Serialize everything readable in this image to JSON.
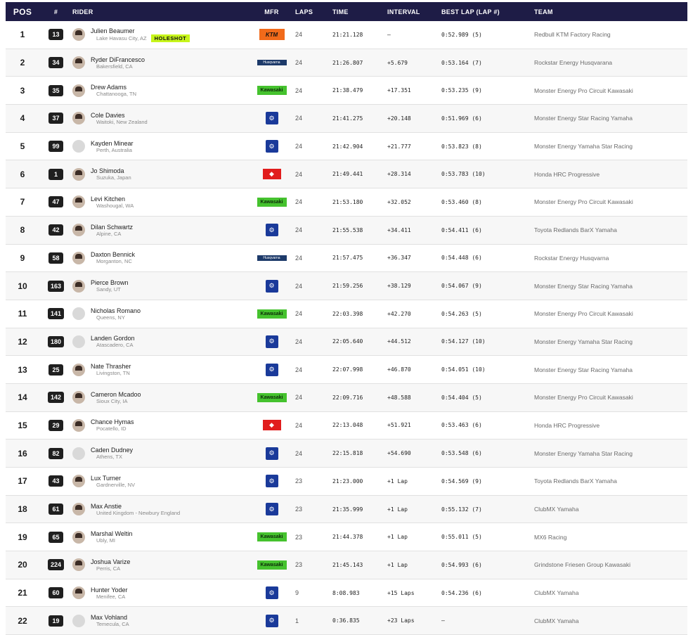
{
  "headers": {
    "pos": "POS",
    "num": "#",
    "rider": "RIDER",
    "mfr": "MFR",
    "laps": "LAPS",
    "time": "TIME",
    "interval": "INTERVAL",
    "best_lap": "BEST LAP (LAP #)",
    "team": "TEAM"
  },
  "holeshot_label": "HOLESHOT",
  "manufacturer_logos": {
    "ktm": "KTM",
    "husqvarna": "Husqvarna",
    "kawasaki": "Kawasaki",
    "yamaha": "⚙",
    "honda": "◆"
  },
  "rows": [
    {
      "pos": "1",
      "num": "13",
      "name": "Julien Beaumer",
      "loc": "Lake Havasu City, AZ",
      "holeshot": true,
      "mfr": "ktm",
      "laps": "24",
      "time": "21:21.128",
      "interval": "–",
      "best": "0:52.989 (5)",
      "team": "Redbull KTM Factory Racing",
      "photo": true
    },
    {
      "pos": "2",
      "num": "34",
      "name": "Ryder DiFrancesco",
      "loc": "Bakersfield, CA",
      "mfr": "husqvarna",
      "laps": "24",
      "time": "21:26.807",
      "interval": "+5.679",
      "best": "0:53.164 (7)",
      "team": "Rockstar Energy Husqvarana",
      "photo": true
    },
    {
      "pos": "3",
      "num": "35",
      "name": "Drew Adams",
      "loc": "Chattanooga, TN",
      "mfr": "kawasaki",
      "laps": "24",
      "time": "21:38.479",
      "interval": "+17.351",
      "best": "0:53.235 (9)",
      "team": "Monster Energy Pro Circuit Kawasaki",
      "photo": true
    },
    {
      "pos": "4",
      "num": "37",
      "name": "Cole Davies",
      "loc": "Waitoki, New Zealand",
      "mfr": "yamaha",
      "laps": "24",
      "time": "21:41.275",
      "interval": "+20.148",
      "best": "0:51.969 (6)",
      "team": "Monster Energy Star Racing Yamaha",
      "photo": true
    },
    {
      "pos": "5",
      "num": "99",
      "name": "Kayden Minear",
      "loc": "Perth, Australia",
      "mfr": "yamaha",
      "laps": "24",
      "time": "21:42.904",
      "interval": "+21.777",
      "best": "0:53.823 (8)",
      "team": "Monster Energy Yamaha Star Racing",
      "photo": false
    },
    {
      "pos": "6",
      "num": "1",
      "name": "Jo Shimoda",
      "loc": "Suzuka, Japan",
      "mfr": "honda",
      "laps": "24",
      "time": "21:49.441",
      "interval": "+28.314",
      "best": "0:53.783 (10)",
      "team": "Honda HRC Progressive",
      "photo": true
    },
    {
      "pos": "7",
      "num": "47",
      "name": "Levi Kitchen",
      "loc": "Washougal, WA",
      "mfr": "kawasaki",
      "laps": "24",
      "time": "21:53.180",
      "interval": "+32.052",
      "best": "0:53.460 (8)",
      "team": "Monster Energy Pro Circuit Kawasaki",
      "photo": true
    },
    {
      "pos": "8",
      "num": "42",
      "name": "Dilan Schwartz",
      "loc": "Alpine, CA",
      "mfr": "yamaha",
      "laps": "24",
      "time": "21:55.538",
      "interval": "+34.411",
      "best": "0:54.411 (6)",
      "team": "Toyota Redlands BarX Yamaha",
      "photo": true
    },
    {
      "pos": "9",
      "num": "58",
      "name": "Daxton Bennick",
      "loc": "Morganton, NC",
      "mfr": "husqvarna",
      "laps": "24",
      "time": "21:57.475",
      "interval": "+36.347",
      "best": "0:54.448 (6)",
      "team": "Rockstar Energy Husqvarna",
      "photo": true
    },
    {
      "pos": "10",
      "num": "163",
      "name": "Pierce Brown",
      "loc": "Sandy, UT",
      "mfr": "yamaha",
      "laps": "24",
      "time": "21:59.256",
      "interval": "+38.129",
      "best": "0:54.067 (9)",
      "team": "Monster Energy Star Racing Yamaha",
      "photo": true
    },
    {
      "pos": "11",
      "num": "141",
      "name": "Nicholas Romano",
      "loc": "Queens, NY",
      "mfr": "kawasaki",
      "laps": "24",
      "time": "22:03.398",
      "interval": "+42.270",
      "best": "0:54.263 (5)",
      "team": "Monster Energy Pro Circuit Kawasaki",
      "photo": false
    },
    {
      "pos": "12",
      "num": "180",
      "name": "Landen Gordon",
      "loc": "Atascadero, CA",
      "mfr": "yamaha",
      "laps": "24",
      "time": "22:05.640",
      "interval": "+44.512",
      "best": "0:54.127 (10)",
      "team": "Monster Energy Yamaha Star Racing",
      "photo": false
    },
    {
      "pos": "13",
      "num": "25",
      "name": "Nate Thrasher",
      "loc": "Livingston, TN",
      "mfr": "yamaha",
      "laps": "24",
      "time": "22:07.998",
      "interval": "+46.870",
      "best": "0:54.051 (10)",
      "team": "Monster Energy Star Racing Yamaha",
      "photo": true
    },
    {
      "pos": "14",
      "num": "142",
      "name": "Cameron Mcadoo",
      "loc": "Sioux City, IA",
      "mfr": "kawasaki",
      "laps": "24",
      "time": "22:09.716",
      "interval": "+48.588",
      "best": "0:54.404 (5)",
      "team": "Monster Energy Pro Circuit Kawasaki",
      "photo": true
    },
    {
      "pos": "15",
      "num": "29",
      "name": "Chance Hymas",
      "loc": "Pocatello, ID",
      "mfr": "honda",
      "laps": "24",
      "time": "22:13.048",
      "interval": "+51.921",
      "best": "0:53.463 (6)",
      "team": "Honda HRC Progressive",
      "photo": true
    },
    {
      "pos": "16",
      "num": "82",
      "name": "Caden Dudney",
      "loc": "Athens, TX",
      "mfr": "yamaha",
      "laps": "24",
      "time": "22:15.818",
      "interval": "+54.690",
      "best": "0:53.548 (6)",
      "team": "Monster Energy Yamaha Star Racing",
      "photo": false
    },
    {
      "pos": "17",
      "num": "43",
      "name": "Lux Turner",
      "loc": "Gardnerville, NV",
      "mfr": "yamaha",
      "laps": "23",
      "time": "21:23.000",
      "interval": "+1 Lap",
      "best": "0:54.569 (9)",
      "team": "Toyota Redlands BarX Yamaha",
      "photo": true
    },
    {
      "pos": "18",
      "num": "61",
      "name": "Max Anstie",
      "loc": "United Kingdom - Newbury England",
      "mfr": "yamaha",
      "laps": "23",
      "time": "21:35.999",
      "interval": "+1 Lap",
      "best": "0:55.132 (7)",
      "team": "ClubMX Yamaha",
      "photo": true
    },
    {
      "pos": "19",
      "num": "65",
      "name": "Marshal Weltin",
      "loc": "Ubly, MI",
      "mfr": "kawasaki",
      "laps": "23",
      "time": "21:44.378",
      "interval": "+1 Lap",
      "best": "0:55.011 (5)",
      "team": "MX6 Racing",
      "photo": true
    },
    {
      "pos": "20",
      "num": "224",
      "name": "Joshua Varize",
      "loc": "Perris, CA",
      "mfr": "kawasaki",
      "laps": "23",
      "time": "21:45.143",
      "interval": "+1 Lap",
      "best": "0:54.993 (6)",
      "team": "Grindstone Friesen Group Kawasaki",
      "photo": true
    },
    {
      "pos": "21",
      "num": "60",
      "name": "Hunter Yoder",
      "loc": "Menifee, CA",
      "mfr": "yamaha",
      "laps": "9",
      "time": "8:08.983",
      "interval": "+15 Laps",
      "best": "0:54.236 (6)",
      "team": "ClubMX Yamaha",
      "photo": true
    },
    {
      "pos": "22",
      "num": "19",
      "name": "Max Vohland",
      "loc": "Temecula, CA",
      "mfr": "yamaha",
      "laps": "1",
      "time": "0:36.835",
      "interval": "+23 Laps",
      "best": "–",
      "team": "ClubMX Yamaha",
      "photo": false
    }
  ]
}
